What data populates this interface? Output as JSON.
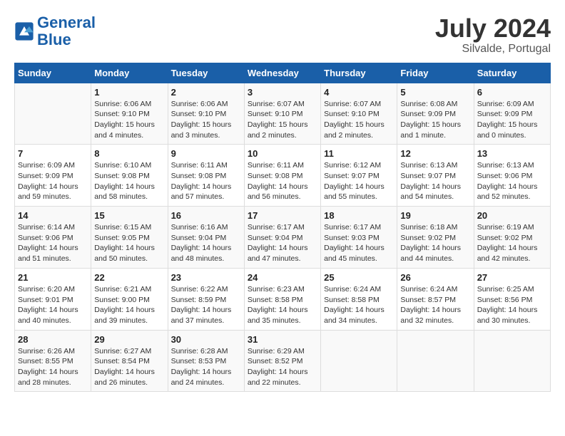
{
  "header": {
    "logo_line1": "General",
    "logo_line2": "Blue",
    "month_year": "July 2024",
    "location": "Silvalde, Portugal"
  },
  "weekdays": [
    "Sunday",
    "Monday",
    "Tuesday",
    "Wednesday",
    "Thursday",
    "Friday",
    "Saturday"
  ],
  "weeks": [
    [
      {
        "day": "",
        "sunrise": "",
        "sunset": "",
        "daylight": ""
      },
      {
        "day": "1",
        "sunrise": "Sunrise: 6:06 AM",
        "sunset": "Sunset: 9:10 PM",
        "daylight": "Daylight: 15 hours and 4 minutes."
      },
      {
        "day": "2",
        "sunrise": "Sunrise: 6:06 AM",
        "sunset": "Sunset: 9:10 PM",
        "daylight": "Daylight: 15 hours and 3 minutes."
      },
      {
        "day": "3",
        "sunrise": "Sunrise: 6:07 AM",
        "sunset": "Sunset: 9:10 PM",
        "daylight": "Daylight: 15 hours and 2 minutes."
      },
      {
        "day": "4",
        "sunrise": "Sunrise: 6:07 AM",
        "sunset": "Sunset: 9:10 PM",
        "daylight": "Daylight: 15 hours and 2 minutes."
      },
      {
        "day": "5",
        "sunrise": "Sunrise: 6:08 AM",
        "sunset": "Sunset: 9:09 PM",
        "daylight": "Daylight: 15 hours and 1 minute."
      },
      {
        "day": "6",
        "sunrise": "Sunrise: 6:09 AM",
        "sunset": "Sunset: 9:09 PM",
        "daylight": "Daylight: 15 hours and 0 minutes."
      }
    ],
    [
      {
        "day": "7",
        "sunrise": "Sunrise: 6:09 AM",
        "sunset": "Sunset: 9:09 PM",
        "daylight": "Daylight: 14 hours and 59 minutes."
      },
      {
        "day": "8",
        "sunrise": "Sunrise: 6:10 AM",
        "sunset": "Sunset: 9:08 PM",
        "daylight": "Daylight: 14 hours and 58 minutes."
      },
      {
        "day": "9",
        "sunrise": "Sunrise: 6:11 AM",
        "sunset": "Sunset: 9:08 PM",
        "daylight": "Daylight: 14 hours and 57 minutes."
      },
      {
        "day": "10",
        "sunrise": "Sunrise: 6:11 AM",
        "sunset": "Sunset: 9:08 PM",
        "daylight": "Daylight: 14 hours and 56 minutes."
      },
      {
        "day": "11",
        "sunrise": "Sunrise: 6:12 AM",
        "sunset": "Sunset: 9:07 PM",
        "daylight": "Daylight: 14 hours and 55 minutes."
      },
      {
        "day": "12",
        "sunrise": "Sunrise: 6:13 AM",
        "sunset": "Sunset: 9:07 PM",
        "daylight": "Daylight: 14 hours and 54 minutes."
      },
      {
        "day": "13",
        "sunrise": "Sunrise: 6:13 AM",
        "sunset": "Sunset: 9:06 PM",
        "daylight": "Daylight: 14 hours and 52 minutes."
      }
    ],
    [
      {
        "day": "14",
        "sunrise": "Sunrise: 6:14 AM",
        "sunset": "Sunset: 9:06 PM",
        "daylight": "Daylight: 14 hours and 51 minutes."
      },
      {
        "day": "15",
        "sunrise": "Sunrise: 6:15 AM",
        "sunset": "Sunset: 9:05 PM",
        "daylight": "Daylight: 14 hours and 50 minutes."
      },
      {
        "day": "16",
        "sunrise": "Sunrise: 6:16 AM",
        "sunset": "Sunset: 9:04 PM",
        "daylight": "Daylight: 14 hours and 48 minutes."
      },
      {
        "day": "17",
        "sunrise": "Sunrise: 6:17 AM",
        "sunset": "Sunset: 9:04 PM",
        "daylight": "Daylight: 14 hours and 47 minutes."
      },
      {
        "day": "18",
        "sunrise": "Sunrise: 6:17 AM",
        "sunset": "Sunset: 9:03 PM",
        "daylight": "Daylight: 14 hours and 45 minutes."
      },
      {
        "day": "19",
        "sunrise": "Sunrise: 6:18 AM",
        "sunset": "Sunset: 9:02 PM",
        "daylight": "Daylight: 14 hours and 44 minutes."
      },
      {
        "day": "20",
        "sunrise": "Sunrise: 6:19 AM",
        "sunset": "Sunset: 9:02 PM",
        "daylight": "Daylight: 14 hours and 42 minutes."
      }
    ],
    [
      {
        "day": "21",
        "sunrise": "Sunrise: 6:20 AM",
        "sunset": "Sunset: 9:01 PM",
        "daylight": "Daylight: 14 hours and 40 minutes."
      },
      {
        "day": "22",
        "sunrise": "Sunrise: 6:21 AM",
        "sunset": "Sunset: 9:00 PM",
        "daylight": "Daylight: 14 hours and 39 minutes."
      },
      {
        "day": "23",
        "sunrise": "Sunrise: 6:22 AM",
        "sunset": "Sunset: 8:59 PM",
        "daylight": "Daylight: 14 hours and 37 minutes."
      },
      {
        "day": "24",
        "sunrise": "Sunrise: 6:23 AM",
        "sunset": "Sunset: 8:58 PM",
        "daylight": "Daylight: 14 hours and 35 minutes."
      },
      {
        "day": "25",
        "sunrise": "Sunrise: 6:24 AM",
        "sunset": "Sunset: 8:58 PM",
        "daylight": "Daylight: 14 hours and 34 minutes."
      },
      {
        "day": "26",
        "sunrise": "Sunrise: 6:24 AM",
        "sunset": "Sunset: 8:57 PM",
        "daylight": "Daylight: 14 hours and 32 minutes."
      },
      {
        "day": "27",
        "sunrise": "Sunrise: 6:25 AM",
        "sunset": "Sunset: 8:56 PM",
        "daylight": "Daylight: 14 hours and 30 minutes."
      }
    ],
    [
      {
        "day": "28",
        "sunrise": "Sunrise: 6:26 AM",
        "sunset": "Sunset: 8:55 PM",
        "daylight": "Daylight: 14 hours and 28 minutes."
      },
      {
        "day": "29",
        "sunrise": "Sunrise: 6:27 AM",
        "sunset": "Sunset: 8:54 PM",
        "daylight": "Daylight: 14 hours and 26 minutes."
      },
      {
        "day": "30",
        "sunrise": "Sunrise: 6:28 AM",
        "sunset": "Sunset: 8:53 PM",
        "daylight": "Daylight: 14 hours and 24 minutes."
      },
      {
        "day": "31",
        "sunrise": "Sunrise: 6:29 AM",
        "sunset": "Sunset: 8:52 PM",
        "daylight": "Daylight: 14 hours and 22 minutes."
      },
      {
        "day": "",
        "sunrise": "",
        "sunset": "",
        "daylight": ""
      },
      {
        "day": "",
        "sunrise": "",
        "sunset": "",
        "daylight": ""
      },
      {
        "day": "",
        "sunrise": "",
        "sunset": "",
        "daylight": ""
      }
    ]
  ]
}
